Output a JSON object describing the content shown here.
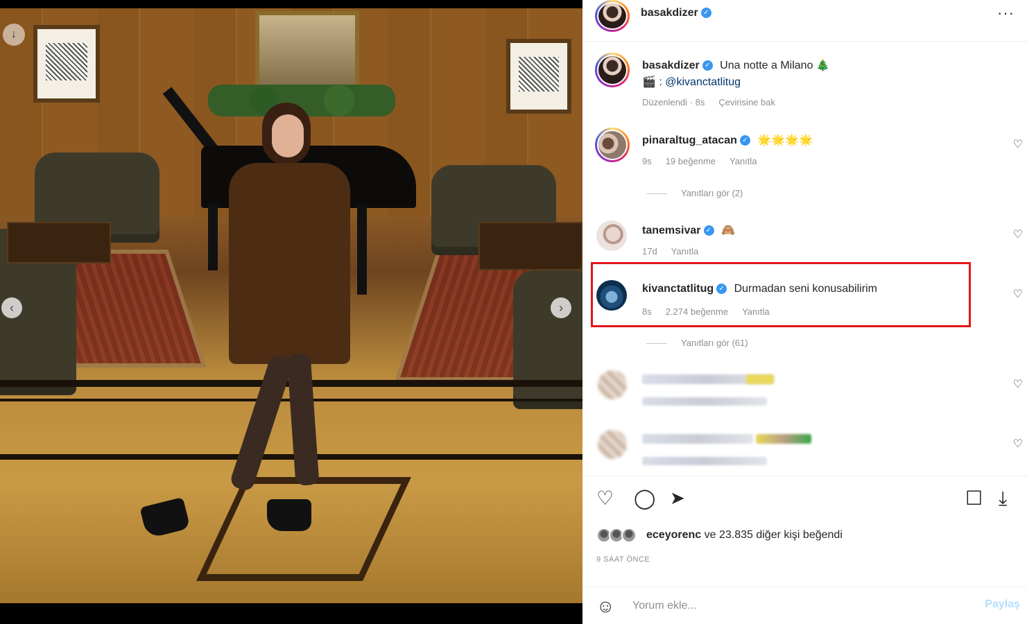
{
  "post": {
    "author": "basakdizer",
    "more_icon": "more-horizontal-icon",
    "photo_alt": "Woman in brown blazer on phone in hotel lobby with grand piano"
  },
  "caption": {
    "username": "basakdizer",
    "text": "Una notte a Milano 🎄",
    "credit": "🎬 : @kivanctatlitug",
    "edited": "Düzenlendi · 8s",
    "translate": "Çevirisine bak"
  },
  "comments": [
    {
      "username": "pinaraltug_atacan",
      "text": "🌟🌟🌟🌟",
      "time": "9s",
      "likes": "19 beğenme",
      "reply": "Yanıtla",
      "view_replies": "Yanıtları gör (2)"
    },
    {
      "username": "tanemsivar",
      "text": "🙈",
      "time": "17d",
      "reply": "Yanıtla"
    },
    {
      "username": "kivanctatlitug",
      "text": "Durmadan seni konusabilirim",
      "time": "8s",
      "likes": "2.274 beğenme",
      "reply": "Yanıtla",
      "view_replies": "Yanıtları gör (61)"
    }
  ],
  "likes_summary": {
    "user": "eceyorenc",
    "rest": " ve 23.835 diğer kişi beğendi"
  },
  "timestamp": "9 SAAT ÖNCE",
  "comment_input": {
    "placeholder": "Yorum ekle...",
    "post_label": "Paylaş"
  },
  "colors": {
    "verified": "#3897f0",
    "highlight": "#e3141b",
    "post_button": "#b2dffc"
  }
}
